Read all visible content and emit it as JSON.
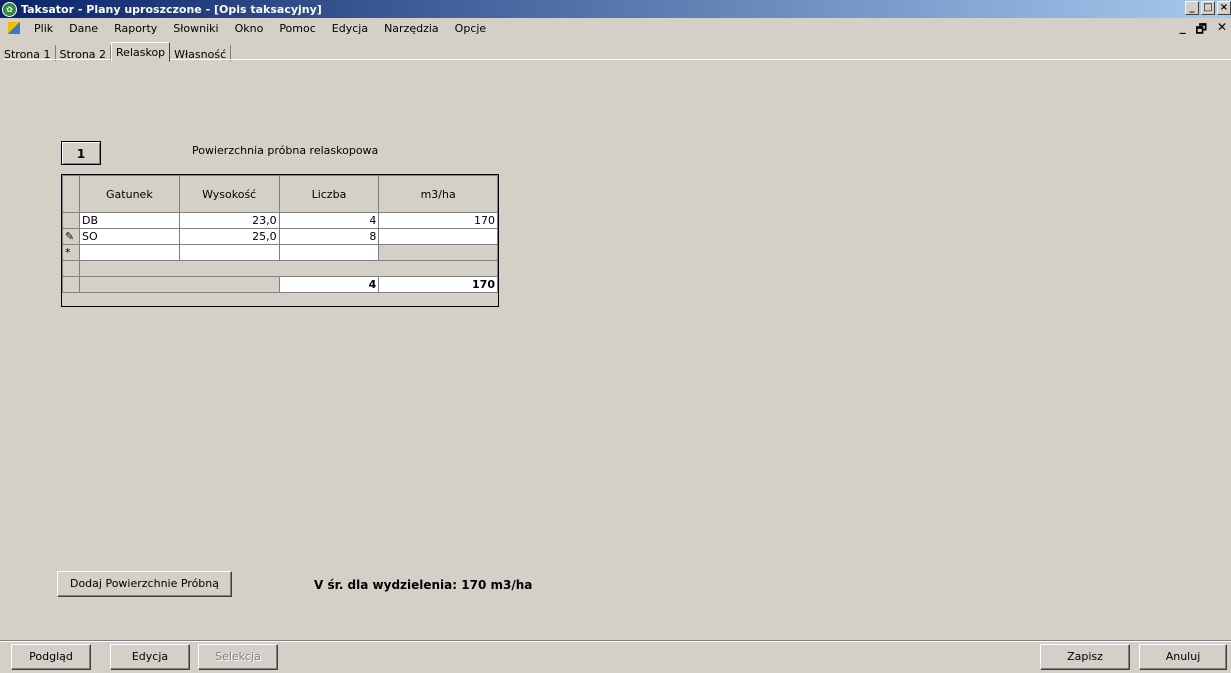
{
  "window": {
    "title": "Taksator - Plany uproszczone - [Opis taksacyjny]"
  },
  "menu": [
    "Plik",
    "Dane",
    "Raporty",
    "Słowniki",
    "Okno",
    "Pomoc",
    "Edycja",
    "Narzędzia",
    "Opcje"
  ],
  "tabs": [
    "Strona 1",
    "Strona 2",
    "Relaskop",
    "Własność"
  ],
  "active_tab": "Relaskop",
  "plot": {
    "number": "1",
    "title": "Powierzchnia próbna relaskopowa"
  },
  "grid": {
    "columns": [
      "Gatunek",
      "Wysokość",
      "Liczba",
      "m3/ha"
    ],
    "rows": [
      {
        "marker": "",
        "gatunek": "DB",
        "wysokosc": "23,0",
        "liczba": "4",
        "m3ha": "170"
      },
      {
        "marker": "✎",
        "gatunek": "SO",
        "wysokosc": "25,0",
        "liczba": "8",
        "m3ha": ""
      }
    ],
    "new_row_marker": "*",
    "totals": {
      "liczba": "4",
      "m3ha": "170"
    }
  },
  "buttons": {
    "add_plot": "Dodaj Powierzchnie Próbną",
    "preview": "Podgląd",
    "edit": "Edycja",
    "selection": "Selekcja",
    "save": "Zapisz",
    "cancel": "Anuluj"
  },
  "summary": "V śr. dla wydzielenia: 170 m3/ha"
}
